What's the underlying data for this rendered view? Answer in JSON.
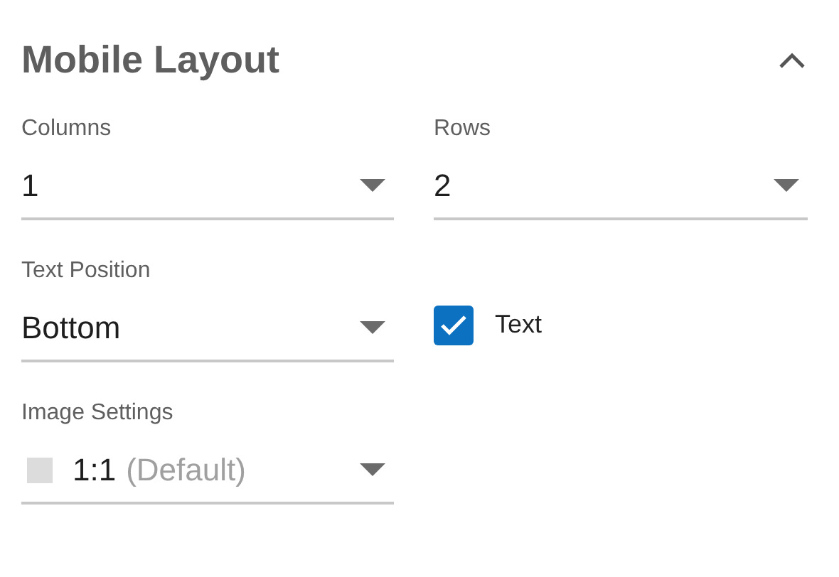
{
  "section": {
    "title": "Mobile Layout",
    "expanded": true
  },
  "fields": [
    {
      "kind": "select",
      "label": "Columns",
      "value": "1"
    },
    {
      "kind": "select",
      "label": "Rows",
      "value": "2"
    },
    {
      "kind": "select",
      "label": "Text Position",
      "value": "Bottom"
    },
    {
      "kind": "checkbox",
      "label": "Text",
      "checked": true
    },
    {
      "kind": "select",
      "label": "Image Settings",
      "value": "1:1",
      "hint": "(Default)",
      "swatch": true
    }
  ]
}
